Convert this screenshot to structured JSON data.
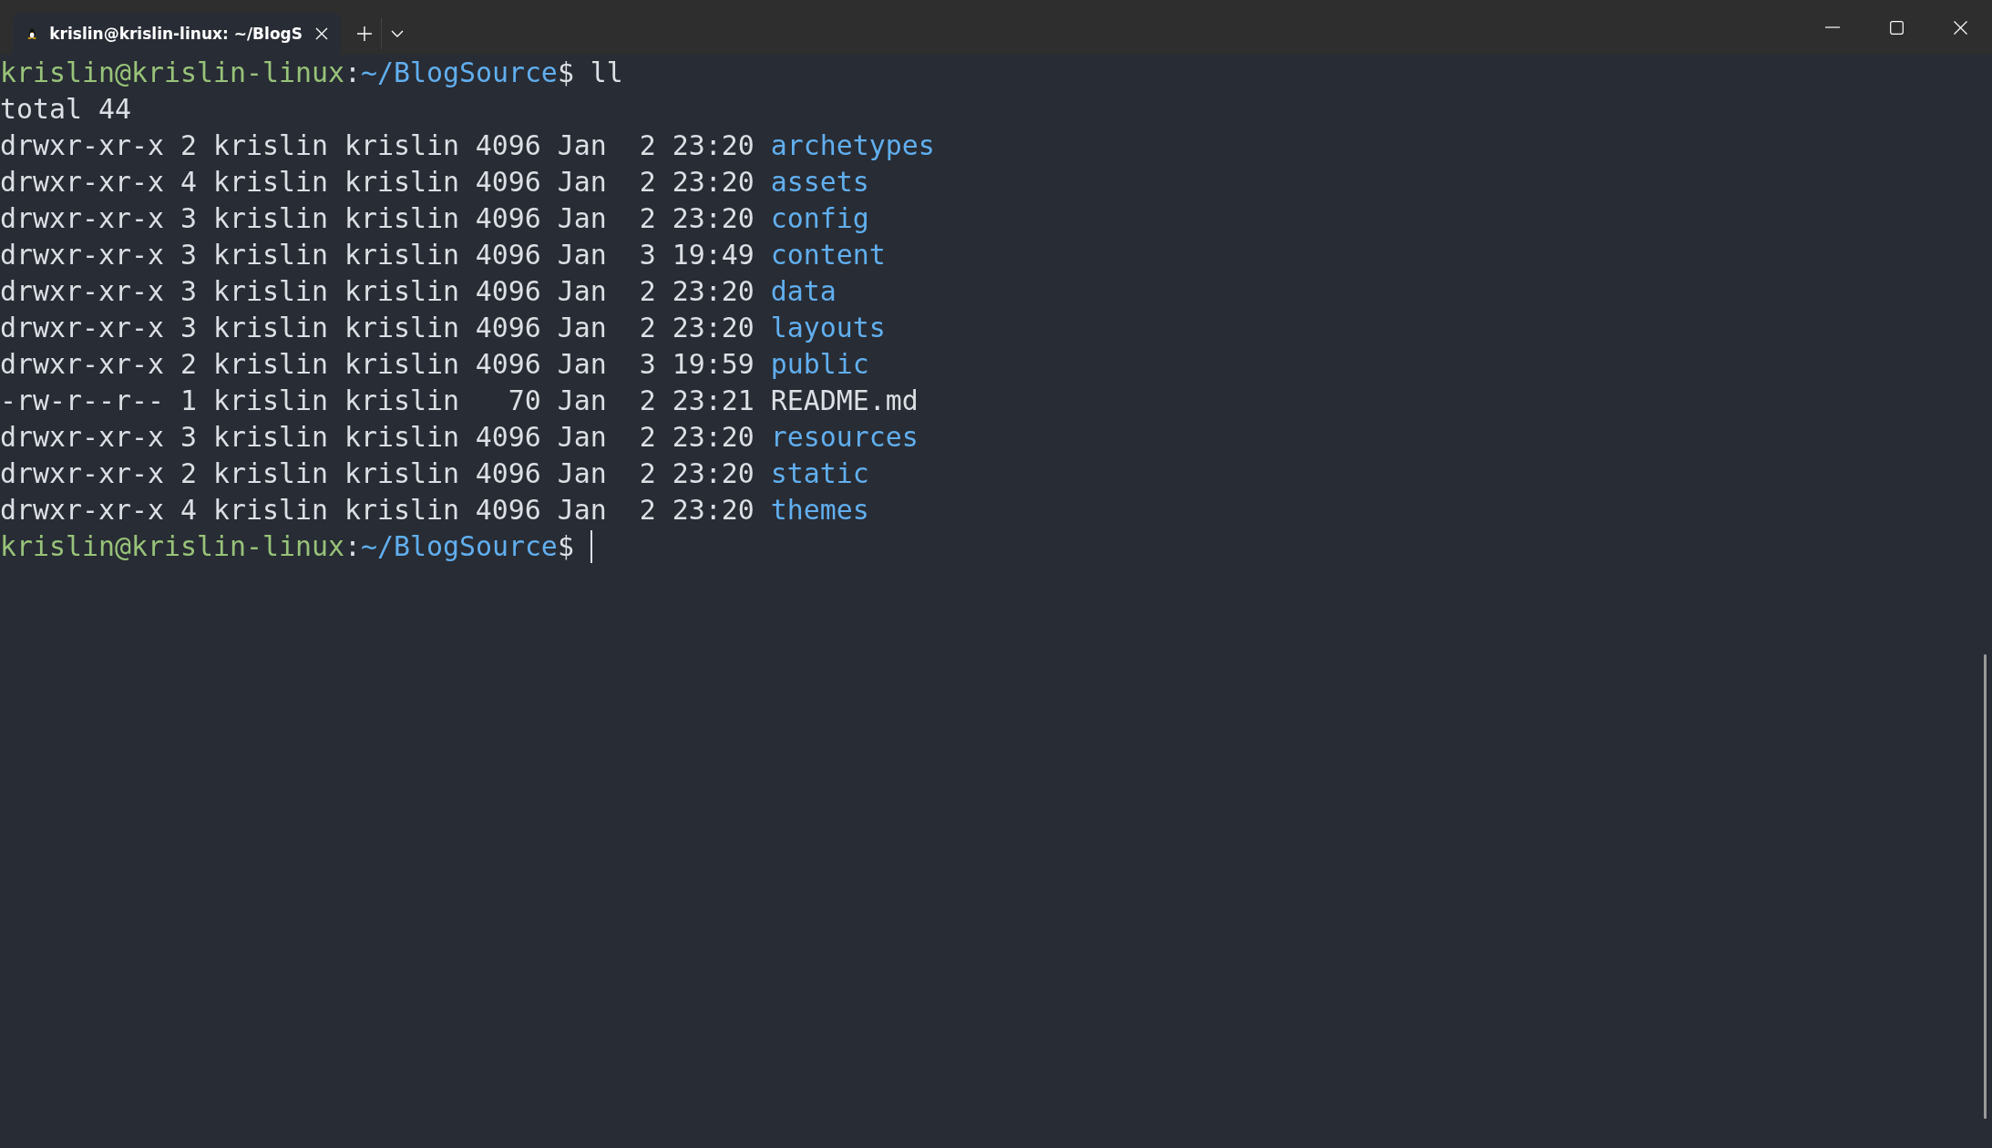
{
  "tab": {
    "title": "krislin@krislin-linux: ~/BlogS",
    "selected": true
  },
  "terminal": {
    "lines": [
      {
        "kind": "prompt",
        "user_host": "krislin@krislin-linux",
        "separator": ":",
        "path": "~/BlogSource",
        "symbol": "$",
        "command": "ll"
      },
      {
        "kind": "output",
        "text": "total 44"
      },
      {
        "kind": "dir",
        "details": "drwxr-xr-x 2 krislin krislin 4096 Jan  2 23:20",
        "name": "archetypes"
      },
      {
        "kind": "dir",
        "details": "drwxr-xr-x 4 krislin krislin 4096 Jan  2 23:20",
        "name": "assets"
      },
      {
        "kind": "dir",
        "details": "drwxr-xr-x 3 krislin krislin 4096 Jan  2 23:20",
        "name": "config"
      },
      {
        "kind": "dir",
        "details": "drwxr-xr-x 3 krislin krislin 4096 Jan  3 19:49",
        "name": "content"
      },
      {
        "kind": "dir",
        "details": "drwxr-xr-x 3 krislin krislin 4096 Jan  2 23:20",
        "name": "data"
      },
      {
        "kind": "dir",
        "details": "drwxr-xr-x 3 krislin krislin 4096 Jan  2 23:20",
        "name": "layouts"
      },
      {
        "kind": "dir",
        "details": "drwxr-xr-x 2 krislin krislin 4096 Jan  3 19:59",
        "name": "public"
      },
      {
        "kind": "file",
        "details": "-rw-r--r-- 1 krislin krislin   70 Jan  2 23:21",
        "name": "README.md"
      },
      {
        "kind": "dir",
        "details": "drwxr-xr-x 3 krislin krislin 4096 Jan  2 23:20",
        "name": "resources"
      },
      {
        "kind": "dir",
        "details": "drwxr-xr-x 2 krislin krislin 4096 Jan  2 23:20",
        "name": "static"
      },
      {
        "kind": "dir",
        "details": "drwxr-xr-x 4 krislin krislin 4096 Jan  2 23:20",
        "name": "themes"
      },
      {
        "kind": "prompt",
        "user_host": "krislin@krislin-linux",
        "separator": ":",
        "path": "~/BlogSource",
        "symbol": "$",
        "cursor": true
      }
    ]
  }
}
